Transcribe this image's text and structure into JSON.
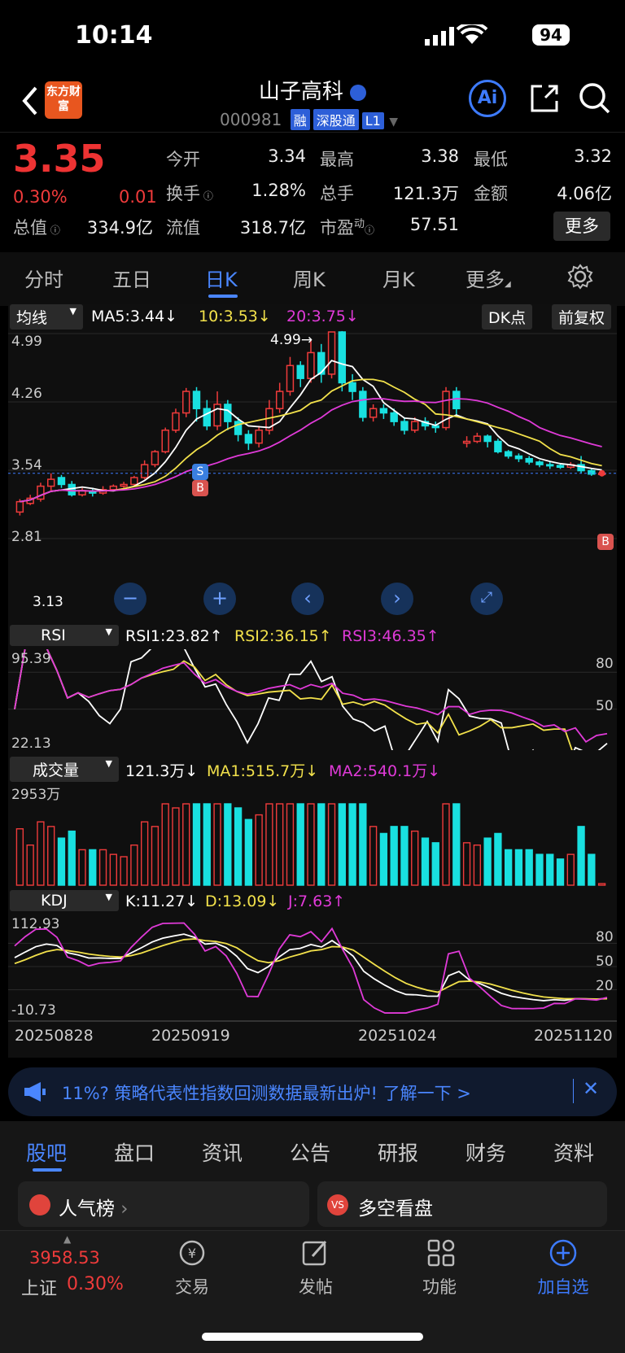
{
  "status": {
    "time": "10:14",
    "battery": "94"
  },
  "header": {
    "logo": "东方财富",
    "name": "山子高科",
    "code": "000981",
    "tags": [
      "融",
      "深股通",
      "L1"
    ],
    "ai_label": "Ai"
  },
  "quote": {
    "price": "3.35",
    "change_pct": "0.30%",
    "change": "0.01",
    "open_label": "今开",
    "open": "3.34",
    "high_label": "最高",
    "high": "3.38",
    "low_label": "最低",
    "low": "3.32",
    "turnover_label": "换手",
    "turnover": "1.28%",
    "volume_label": "总手",
    "volume": "121.3万",
    "amount_label": "金额",
    "amount": "4.06亿",
    "mktcap_label": "总值",
    "mktcap": "334.9亿",
    "float_label": "流值",
    "float": "318.7亿",
    "pe_label": "市盈",
    "pe_sup": "动",
    "pe": "57.51",
    "more": "更多"
  },
  "tabs": [
    "分时",
    "五日",
    "日K",
    "周K",
    "月K",
    "更多"
  ],
  "active_tab": "日K",
  "kline": {
    "ma_select": "均线",
    "ma5": "MA5:3.44↓",
    "ma10": "10:3.53↓",
    "ma20": "20:3.75↓",
    "dk": "DK点",
    "adjust": "前复权",
    "yticks": [
      "4.99",
      "4.26",
      "3.54",
      "2.81"
    ],
    "peak_label": "4.99→",
    "low_label": "3.13"
  },
  "rsi": {
    "select": "RSI",
    "rsi1": "RSI1:23.82↑",
    "rsi2": "RSI2:36.15↑",
    "rsi3": "RSI3:46.35↑",
    "top": "95.39",
    "bottom": "22.13",
    "levels": [
      "80",
      "50"
    ]
  },
  "vol": {
    "select": "成交量",
    "v": "121.3万↓",
    "ma1": "MA1:515.7万↓",
    "ma2": "MA2:540.1万↓",
    "top": "2953万"
  },
  "kdj": {
    "select": "KDJ",
    "k": "K:11.27↓",
    "d": "D:13.09↓",
    "j": "J:7.63↑",
    "top": "112.93",
    "bottom": "-10.73",
    "levels": [
      "80",
      "50",
      "20"
    ]
  },
  "dates": [
    "20250828",
    "20250919",
    "20251024",
    "20251120"
  ],
  "banner": {
    "text": "11%? 策略代表性指数回测数据最新出炉! 了解一下 >"
  },
  "bottom_tabs": [
    "股吧",
    "盘口",
    "资讯",
    "公告",
    "研报",
    "财务",
    "资料"
  ],
  "cards": [
    "人气榜",
    "多空看盘"
  ],
  "navbar": {
    "index_value": "3958.53",
    "index_name": "上证",
    "index_pct": "0.30%",
    "items": [
      "交易",
      "发帖",
      "功能",
      "加自选"
    ]
  },
  "colors": {
    "up": "#ef3b3b",
    "down": "#19e0e0",
    "ma5": "#ffffff",
    "ma10": "#f2e14b",
    "ma20": "#e03ad8",
    "accent": "#3d7bff"
  },
  "chart_data": {
    "type": "candlestick",
    "title": "日K",
    "x": [
      "20250828",
      "20250919",
      "20251024",
      "20251120"
    ],
    "candles": [
      [
        2.9,
        3.02,
        2.86,
        3.05
      ],
      [
        3.0,
        3.06,
        2.98,
        3.1
      ],
      [
        3.05,
        3.2,
        3.02,
        3.24
      ],
      [
        3.2,
        3.28,
        3.15,
        3.35
      ],
      [
        3.3,
        3.22,
        3.18,
        3.33
      ],
      [
        3.22,
        3.1,
        3.08,
        3.26
      ],
      [
        3.1,
        3.15,
        3.08,
        3.18
      ],
      [
        3.14,
        3.12,
        3.08,
        3.18
      ],
      [
        3.12,
        3.16,
        3.1,
        3.2
      ],
      [
        3.16,
        3.2,
        3.14,
        3.22
      ],
      [
        3.2,
        3.22,
        3.18,
        3.25
      ],
      [
        3.22,
        3.3,
        3.2,
        3.32
      ],
      [
        3.3,
        3.45,
        3.28,
        3.5
      ],
      [
        3.45,
        3.6,
        3.42,
        3.62
      ],
      [
        3.6,
        3.85,
        3.58,
        3.88
      ],
      [
        3.85,
        4.05,
        3.82,
        4.1
      ],
      [
        4.05,
        4.3,
        4.0,
        4.34
      ],
      [
        4.3,
        4.1,
        3.95,
        4.35
      ],
      [
        4.1,
        3.9,
        3.85,
        4.2
      ],
      [
        3.9,
        4.15,
        3.85,
        4.3
      ],
      [
        4.15,
        3.95,
        3.85,
        4.2
      ],
      [
        3.95,
        3.8,
        3.72,
        4.0
      ],
      [
        3.8,
        3.7,
        3.62,
        3.85
      ],
      [
        3.7,
        3.85,
        3.65,
        3.9
      ],
      [
        3.85,
        4.1,
        3.8,
        4.2
      ],
      [
        4.1,
        4.3,
        4.05,
        4.4
      ],
      [
        4.3,
        4.6,
        4.25,
        4.7
      ],
      [
        4.6,
        4.45,
        4.35,
        4.65
      ],
      [
        4.45,
        4.75,
        4.4,
        4.9
      ],
      [
        4.75,
        4.5,
        4.4,
        4.85
      ],
      [
        4.5,
        4.99,
        4.45,
        4.99
      ],
      [
        4.99,
        4.4,
        4.3,
        5.0
      ],
      [
        4.4,
        4.3,
        4.2,
        4.5
      ],
      [
        4.3,
        4.0,
        3.95,
        4.35
      ],
      [
        4.0,
        4.1,
        3.95,
        4.15
      ],
      [
        4.1,
        4.05,
        3.98,
        4.15
      ],
      [
        4.05,
        3.95,
        3.9,
        4.1
      ],
      [
        3.95,
        3.85,
        3.8,
        4.0
      ],
      [
        3.85,
        3.95,
        3.82,
        4.0
      ],
      [
        3.95,
        3.9,
        3.85,
        4.0
      ],
      [
        3.9,
        3.88,
        3.82,
        3.95
      ],
      [
        3.88,
        4.3,
        3.85,
        4.35
      ],
      [
        4.3,
        4.1,
        4.0,
        4.35
      ],
      [
        3.7,
        3.72,
        3.65,
        3.78
      ],
      [
        3.72,
        3.78,
        3.7,
        3.82
      ],
      [
        3.78,
        3.72,
        3.65,
        3.8
      ],
      [
        3.72,
        3.6,
        3.58,
        3.75
      ],
      [
        3.6,
        3.55,
        3.52,
        3.62
      ],
      [
        3.55,
        3.52,
        3.48,
        3.58
      ],
      [
        3.52,
        3.48,
        3.45,
        3.55
      ],
      [
        3.48,
        3.45,
        3.42,
        3.5
      ],
      [
        3.45,
        3.44,
        3.4,
        3.48
      ],
      [
        3.44,
        3.42,
        3.4,
        3.46
      ],
      [
        3.42,
        3.45,
        3.4,
        3.48
      ],
      [
        3.45,
        3.38,
        3.35,
        3.55
      ],
      [
        3.38,
        3.34,
        3.32,
        3.4
      ],
      [
        3.34,
        3.35,
        3.32,
        3.38
      ]
    ],
    "ylim": [
      2.81,
      4.99
    ],
    "rsi": {
      "rsi1_last": 23.82,
      "rsi2_last": 36.15,
      "rsi3_last": 46.35,
      "ylim": [
        22.13,
        95.39
      ]
    },
    "volume": {
      "last": "121.3万",
      "ma1": "515.7万",
      "ma2": "540.1万",
      "max": "2953万"
    },
    "kdj": {
      "k": 11.27,
      "d": 13.09,
      "j": 7.63,
      "ylim": [
        -10.73,
        112.93
      ]
    }
  }
}
